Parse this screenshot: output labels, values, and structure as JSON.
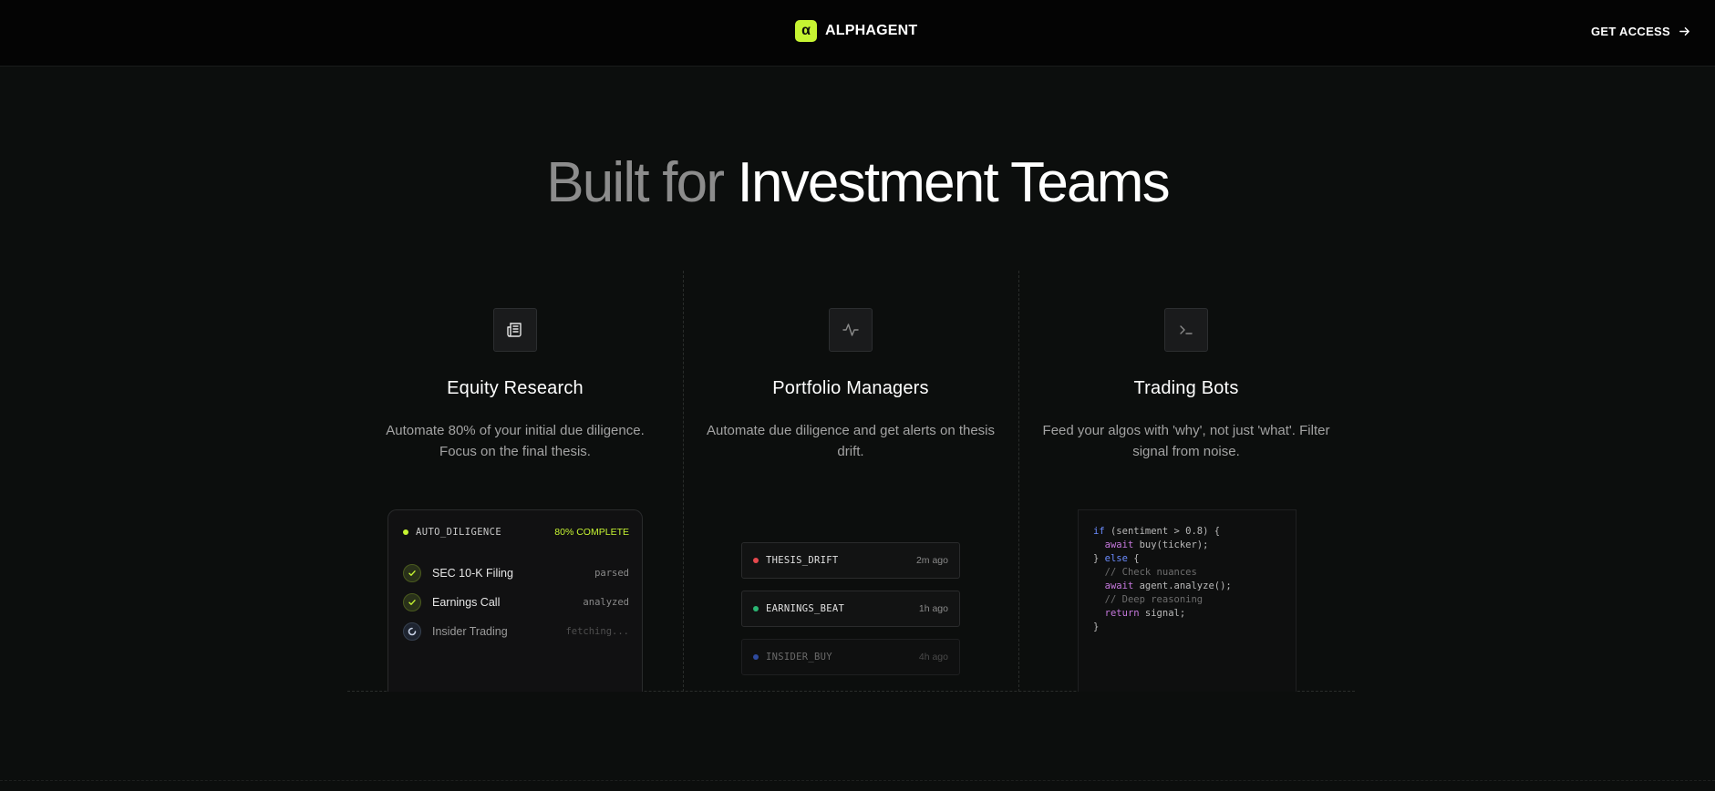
{
  "header": {
    "brand_mark": "α",
    "brand_name": "ALPHAGENT",
    "cta_label": "GET ACCESS"
  },
  "hero": {
    "title_muted": "Built for",
    "title_strong": "Investment Teams"
  },
  "colors": {
    "accent": "#c6f432",
    "background": "#0c0e0d",
    "alert_red": "#e5484d",
    "alert_green": "#2bb673",
    "alert_blue": "#3b5bdb"
  },
  "columns": [
    {
      "icon": "newspaper-icon",
      "title": "Equity Research",
      "description": "Automate 80% of your initial due diligence. Focus on the final thesis."
    },
    {
      "icon": "activity-pulse-icon",
      "title": "Portfolio Managers",
      "description": "Automate due diligence and get alerts on thesis drift."
    },
    {
      "icon": "terminal-icon",
      "title": "Trading Bots",
      "description": "Feed your algos with 'why', not just 'what'. Filter signal from noise."
    }
  ],
  "diligence_card": {
    "label": "AUTO_DILIGENCE",
    "status": "80% COMPLETE",
    "progress": 0.8,
    "rows": [
      {
        "label": "SEC 10-K Filing",
        "state": "parsed",
        "done": true
      },
      {
        "label": "Earnings Call",
        "state": "analyzed",
        "done": true
      },
      {
        "label": "Insider Trading",
        "state": "fetching...",
        "done": false
      }
    ]
  },
  "alerts": [
    {
      "name": "THESIS_DRIFT",
      "time": "2m ago",
      "color": "red"
    },
    {
      "name": "EARNINGS_BEAT",
      "time": "1h ago",
      "color": "green"
    },
    {
      "name": "INSIDER_BUY",
      "time": "4h ago",
      "color": "blue"
    }
  ],
  "code": {
    "line1_kw": "if",
    "line1_rest": " (sentiment > 0.8) {",
    "line2_kw": "await",
    "line2_rest": " buy(ticker);",
    "line3_pre": "} ",
    "line3_kw": "else",
    "line3_rest": " {",
    "line4": "// Check nuances",
    "line5_kw": "await",
    "line5_rest": " agent.analyze();",
    "line6": "// Deep reasoning",
    "line7_kw": "return",
    "line7_rest": " signal;",
    "line8": "}"
  }
}
